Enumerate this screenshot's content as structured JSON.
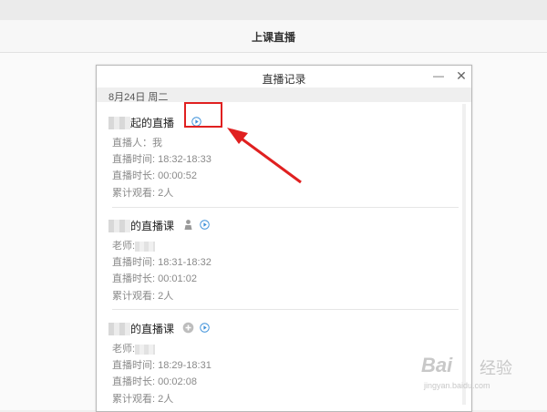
{
  "header": {
    "title": "上课直播"
  },
  "dialog": {
    "title": "直播记录",
    "minimize_glyph": "—",
    "close_glyph": "✕",
    "date": "8月24日 周二"
  },
  "records": [
    {
      "title": "发起的直播",
      "title_visible": "起的直播",
      "host_label": "直播人：我",
      "time": "直播时间: 18:32-18:33",
      "duration": "直播时长: 00:00:52",
      "viewers": "累计观看: 2人",
      "icons": [
        "play-icon"
      ]
    },
    {
      "title_visible": "的直播课",
      "host_label": "老师:",
      "time": "直播时间: 18:31-18:32",
      "duration": "直播时长: 00:01:02",
      "viewers": "累计观看: 2人",
      "icons": [
        "person-icon",
        "play-icon"
      ]
    },
    {
      "title_visible": "的直播课",
      "host_label": "老师:",
      "time": "直播时间: 18:29-18:31",
      "duration": "直播时长: 00:02:08",
      "viewers": "累计观看: 2人",
      "icons": [
        "plus-icon",
        "play-icon"
      ]
    }
  ],
  "annotation": {
    "color": "#e02020"
  },
  "watermark": {
    "brand": "Bai",
    "brand2": "经验",
    "url": "jingyan.baidu.com"
  },
  "colors": {
    "accent": "#3a8fd9",
    "text": "#333333",
    "muted": "#8a8a8a"
  }
}
